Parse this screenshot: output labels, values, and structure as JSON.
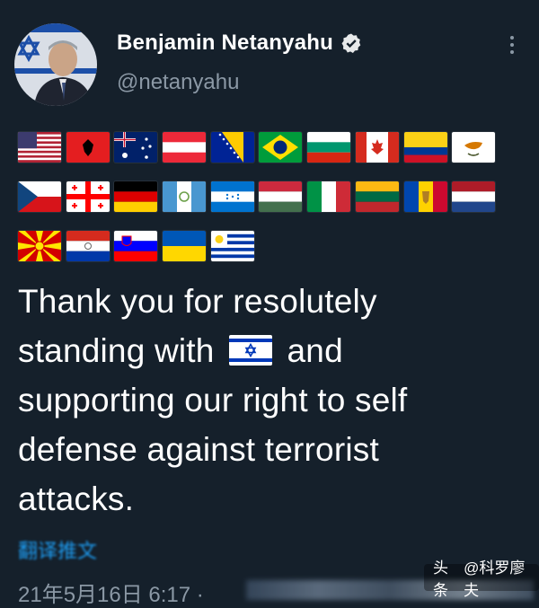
{
  "tweet": {
    "author_name": "Benjamin Netanyahu",
    "handle": "@netanyahu",
    "text_lines": [
      "Thank you for resolutely",
      "standing with",
      "and",
      "supporting our right to self",
      "defense against terrorist",
      "attacks."
    ],
    "inline_flag_icon": "israel-flag-icon",
    "translate_label": "翻译推文",
    "date_text": "21年5月16日 6:17 ·"
  },
  "flags": [
    [
      "united-states",
      "albania",
      "australia",
      "austria",
      "bosnia-and-herzegovina",
      "brazil",
      "bulgaria",
      "canada",
      "colombia",
      "cyprus"
    ],
    [
      "czech-republic",
      "georgia",
      "germany",
      "guatemala",
      "honduras",
      "hungary",
      "italy",
      "lithuania",
      "moldova",
      "netherlands"
    ],
    [
      "north-macedonia",
      "paraguay",
      "slovenia",
      "ukraine",
      "uruguay"
    ]
  ],
  "watermark": {
    "platform": "头条",
    "account": "@科罗廖夫"
  },
  "colors": {
    "background": "#15202b",
    "text": "#ffffff",
    "secondary": "#8b98a5",
    "accent": "#1d9bf0"
  }
}
